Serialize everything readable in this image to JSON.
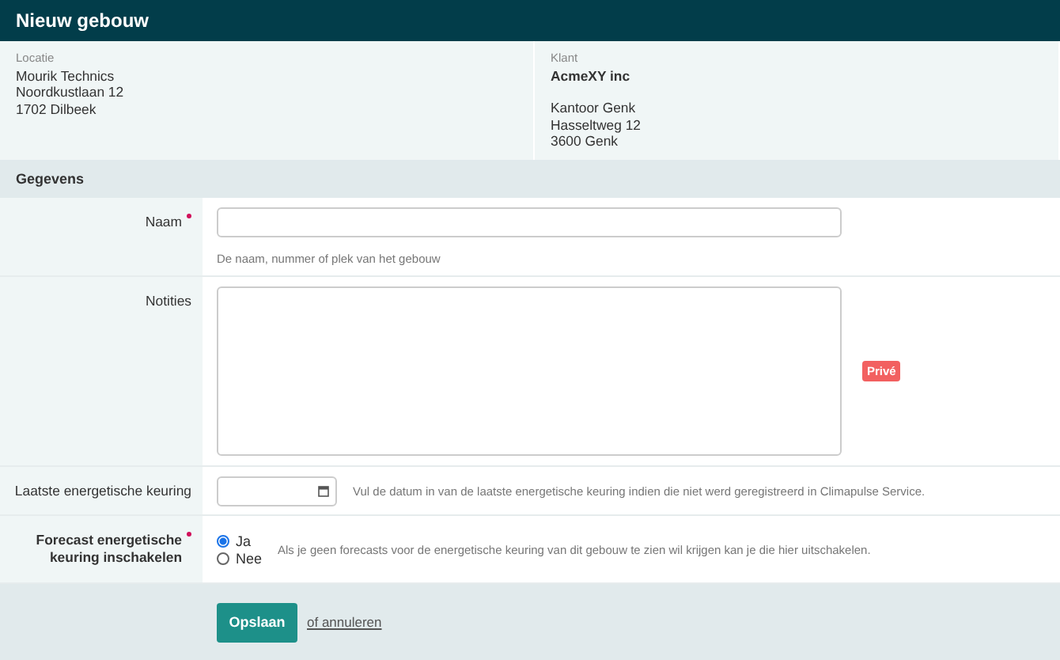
{
  "title": "Nieuw gebouw",
  "info": [
    {
      "label": "Locatie",
      "lines": [
        "Mourik Technics",
        "Noordkustlaan 12",
        "1702 Dilbeek"
      ]
    },
    {
      "label": "Klant",
      "name": "AcmeXY inc",
      "lines": [
        "Kantoor Genk",
        "Hasseltweg 12",
        "3600 Genk"
      ]
    }
  ],
  "section": "Gegevens",
  "fields": [
    {
      "kind": "text",
      "label": "Naam",
      "required": true,
      "help": "De naam, nummer of plek van het gebouw"
    },
    {
      "kind": "textarea",
      "label": "Notities",
      "required": false,
      "badge": "Privé"
    },
    {
      "kind": "date",
      "label": "Laatste energetische keuring",
      "required": false,
      "help": "Vul de datum in van de laatste energetische keuring indien die niet werd geregistreerd in Climapulse Service."
    },
    {
      "kind": "radio",
      "label": "Forecast energetische keuring inschakelen",
      "required": true,
      "options": [
        {
          "label": "Ja",
          "selected": true
        },
        {
          "label": "Nee",
          "selected": false
        }
      ],
      "help": "Als je geen forecasts voor de energetische keuring van dit gebouw te zien wil krijgen kan je die hier uitschakelen."
    }
  ],
  "actions": {
    "save": "Opslaan",
    "cancel": "of annuleren"
  }
}
